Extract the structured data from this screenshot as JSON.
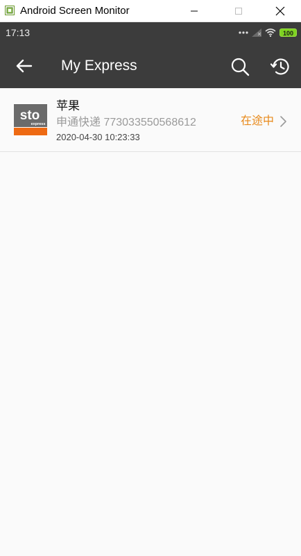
{
  "window": {
    "title": "Android Screen Monitor",
    "app_icon": "android-monitor-icon",
    "buttons": [
      "minimize-icon",
      "maximize-icon",
      "close-icon"
    ]
  },
  "status_bar": {
    "time": "17:13",
    "icons": [
      "dots-icon",
      "signal-icon",
      "wifi-icon"
    ],
    "battery": "100",
    "battery_color": "#7ed321"
  },
  "app_bar": {
    "title": "My Express",
    "background": "#3c3c3c",
    "back_icon": "arrow-left-icon",
    "actions": [
      "search-icon",
      "history-icon"
    ]
  },
  "shipments": [
    {
      "carrier_logo": {
        "text": "sto",
        "subtext": "express",
        "accent": "#ee6a13"
      },
      "name": "苹果",
      "tracking": "申通快递 773033550568612",
      "date": "2020-04-30 10:23:33",
      "status": "在途中",
      "status_color": "#e8891a"
    }
  ]
}
